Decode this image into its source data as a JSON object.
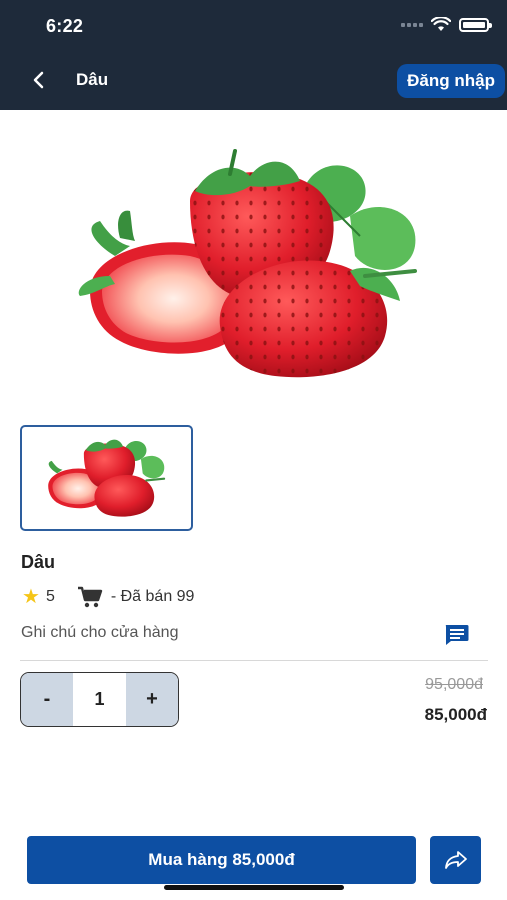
{
  "status_bar": {
    "time": "6:22"
  },
  "nav": {
    "title": "Dâu",
    "login_label": "Đăng nhập"
  },
  "product": {
    "name": "Dâu",
    "rating": "5",
    "sold_text": "- Đã bán 99",
    "note_label": "Ghi chú cho cửa hàng",
    "quantity": "1",
    "decrement_label": "-",
    "increment_label": "+",
    "original_price": "95,000đ",
    "price": "85,000đ"
  },
  "footer": {
    "buy_label": "Mua hàng 85,000đ"
  },
  "colors": {
    "header_bg": "#1e2a3a",
    "primary": "#0d4fa3",
    "stepper_bg": "#cdd7e3"
  }
}
